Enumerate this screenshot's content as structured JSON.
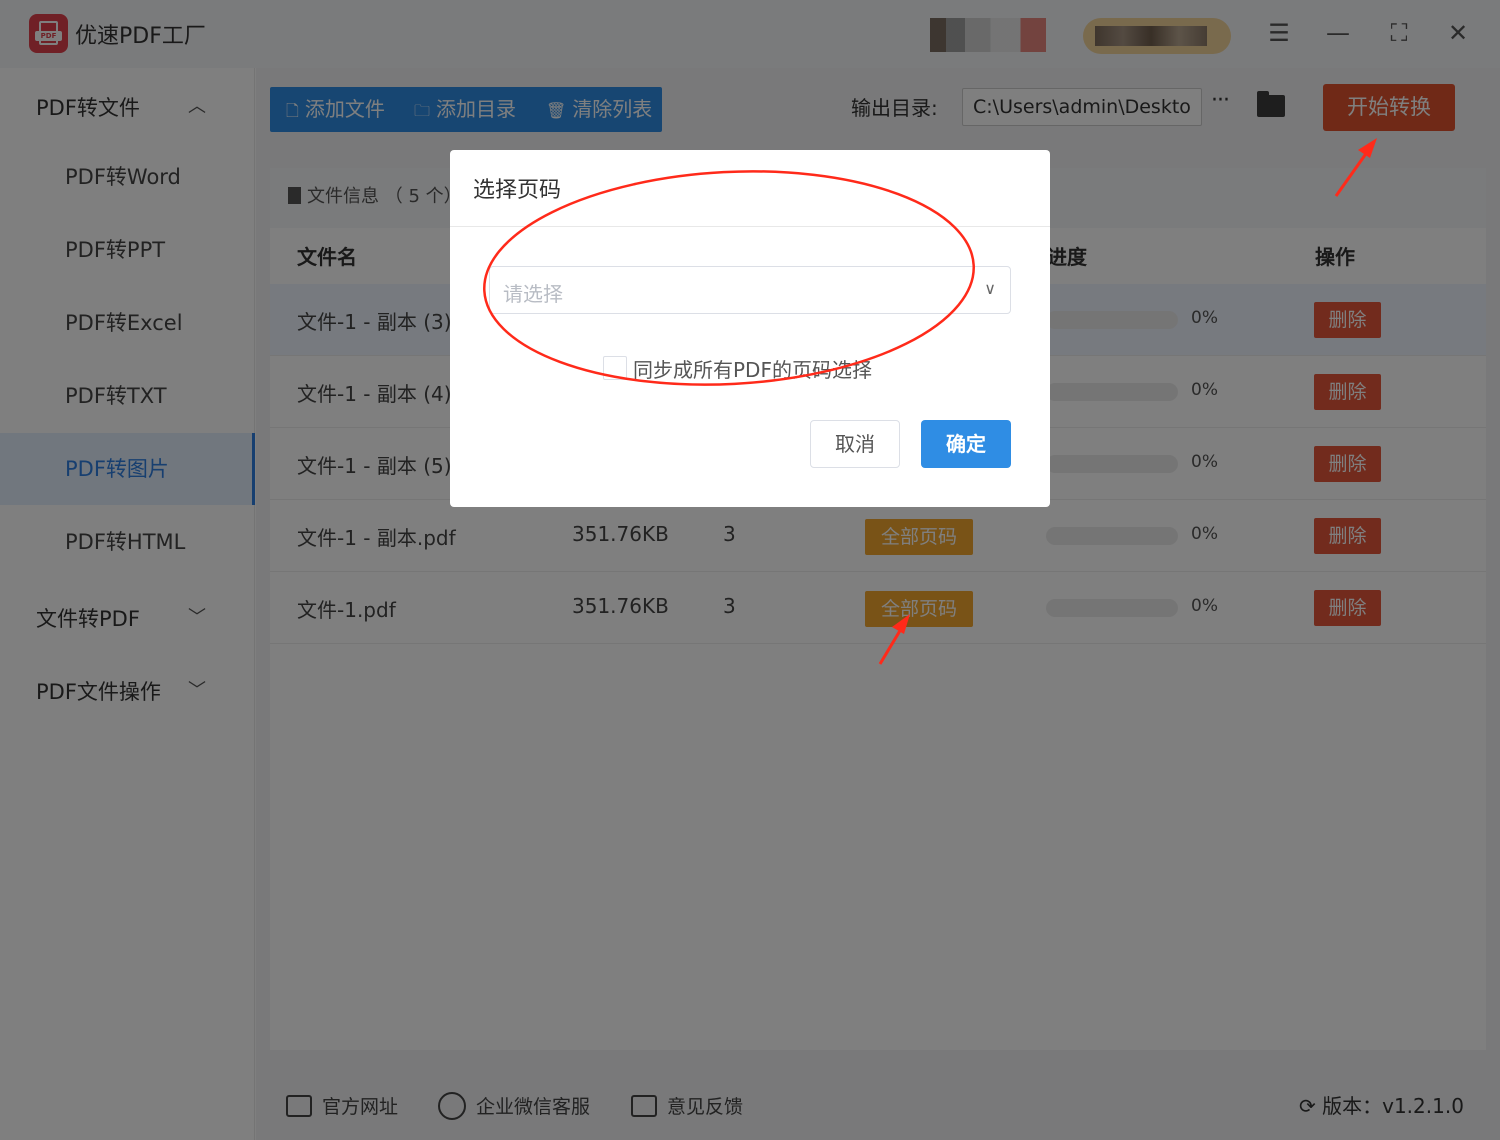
{
  "app": {
    "title": "优速PDF工厂",
    "logo_text": "PDF"
  },
  "window": {
    "menu_icon": "☰",
    "min_icon": "—",
    "max_icon": "⛶",
    "close_icon": "✕"
  },
  "sidebar": {
    "groups": [
      {
        "label": "PDF转文件",
        "chevron": "︿"
      },
      {
        "label": "文件转PDF",
        "chevron": "﹀"
      },
      {
        "label": "PDF文件操作",
        "chevron": "﹀"
      }
    ],
    "items": [
      {
        "label": "PDF转Word"
      },
      {
        "label": "PDF转PPT"
      },
      {
        "label": "PDF转Excel"
      },
      {
        "label": "PDF转TXT"
      },
      {
        "label": "PDF转图片"
      },
      {
        "label": "PDF转HTML"
      }
    ]
  },
  "toolbar": {
    "add_file": "添加文件",
    "add_dir": "添加目录",
    "clear": "清除列表",
    "output_label": "输出目录:",
    "output_path": "C:\\Users\\admin\\Deskto",
    "more": "···",
    "start": "开始转换"
  },
  "file_panel": {
    "info": "文件信息 （ 5 个）",
    "headers": {
      "name": "文件名",
      "progress": "进度",
      "op": "操作"
    },
    "rows": [
      {
        "name": "文件-1 - 副本 (3)",
        "size": "",
        "pages": "",
        "range": "",
        "progress": "0%",
        "delete": "删除"
      },
      {
        "name": "文件-1 - 副本 (4)",
        "size": "",
        "pages": "",
        "range": "",
        "progress": "0%",
        "delete": "删除"
      },
      {
        "name": "文件-1 - 副本 (5)",
        "size": "",
        "pages": "",
        "range": "",
        "progress": "0%",
        "delete": "删除"
      },
      {
        "name": "文件-1 - 副本.pdf",
        "size": "351.76KB",
        "pages": "3",
        "range": "全部页码",
        "progress": "0%",
        "delete": "删除"
      },
      {
        "name": "文件-1.pdf",
        "size": "351.76KB",
        "pages": "3",
        "range": "全部页码",
        "progress": "0%",
        "delete": "删除"
      }
    ]
  },
  "footer": {
    "site": "官方网址",
    "wechat": "企业微信客服",
    "feedback": "意见反馈",
    "version": "版本：v1.2.1.0"
  },
  "modal": {
    "title": "选择页码",
    "select_placeholder": "请选择",
    "sync_label": "同步成所有PDF的页码选择",
    "cancel": "取消",
    "ok": "确定"
  },
  "colors": {
    "accent": "#2f8de4",
    "start": "#e1532f",
    "range": "#f3a72e",
    "delete": "#e5573b",
    "annotation": "#ff2a1a"
  }
}
